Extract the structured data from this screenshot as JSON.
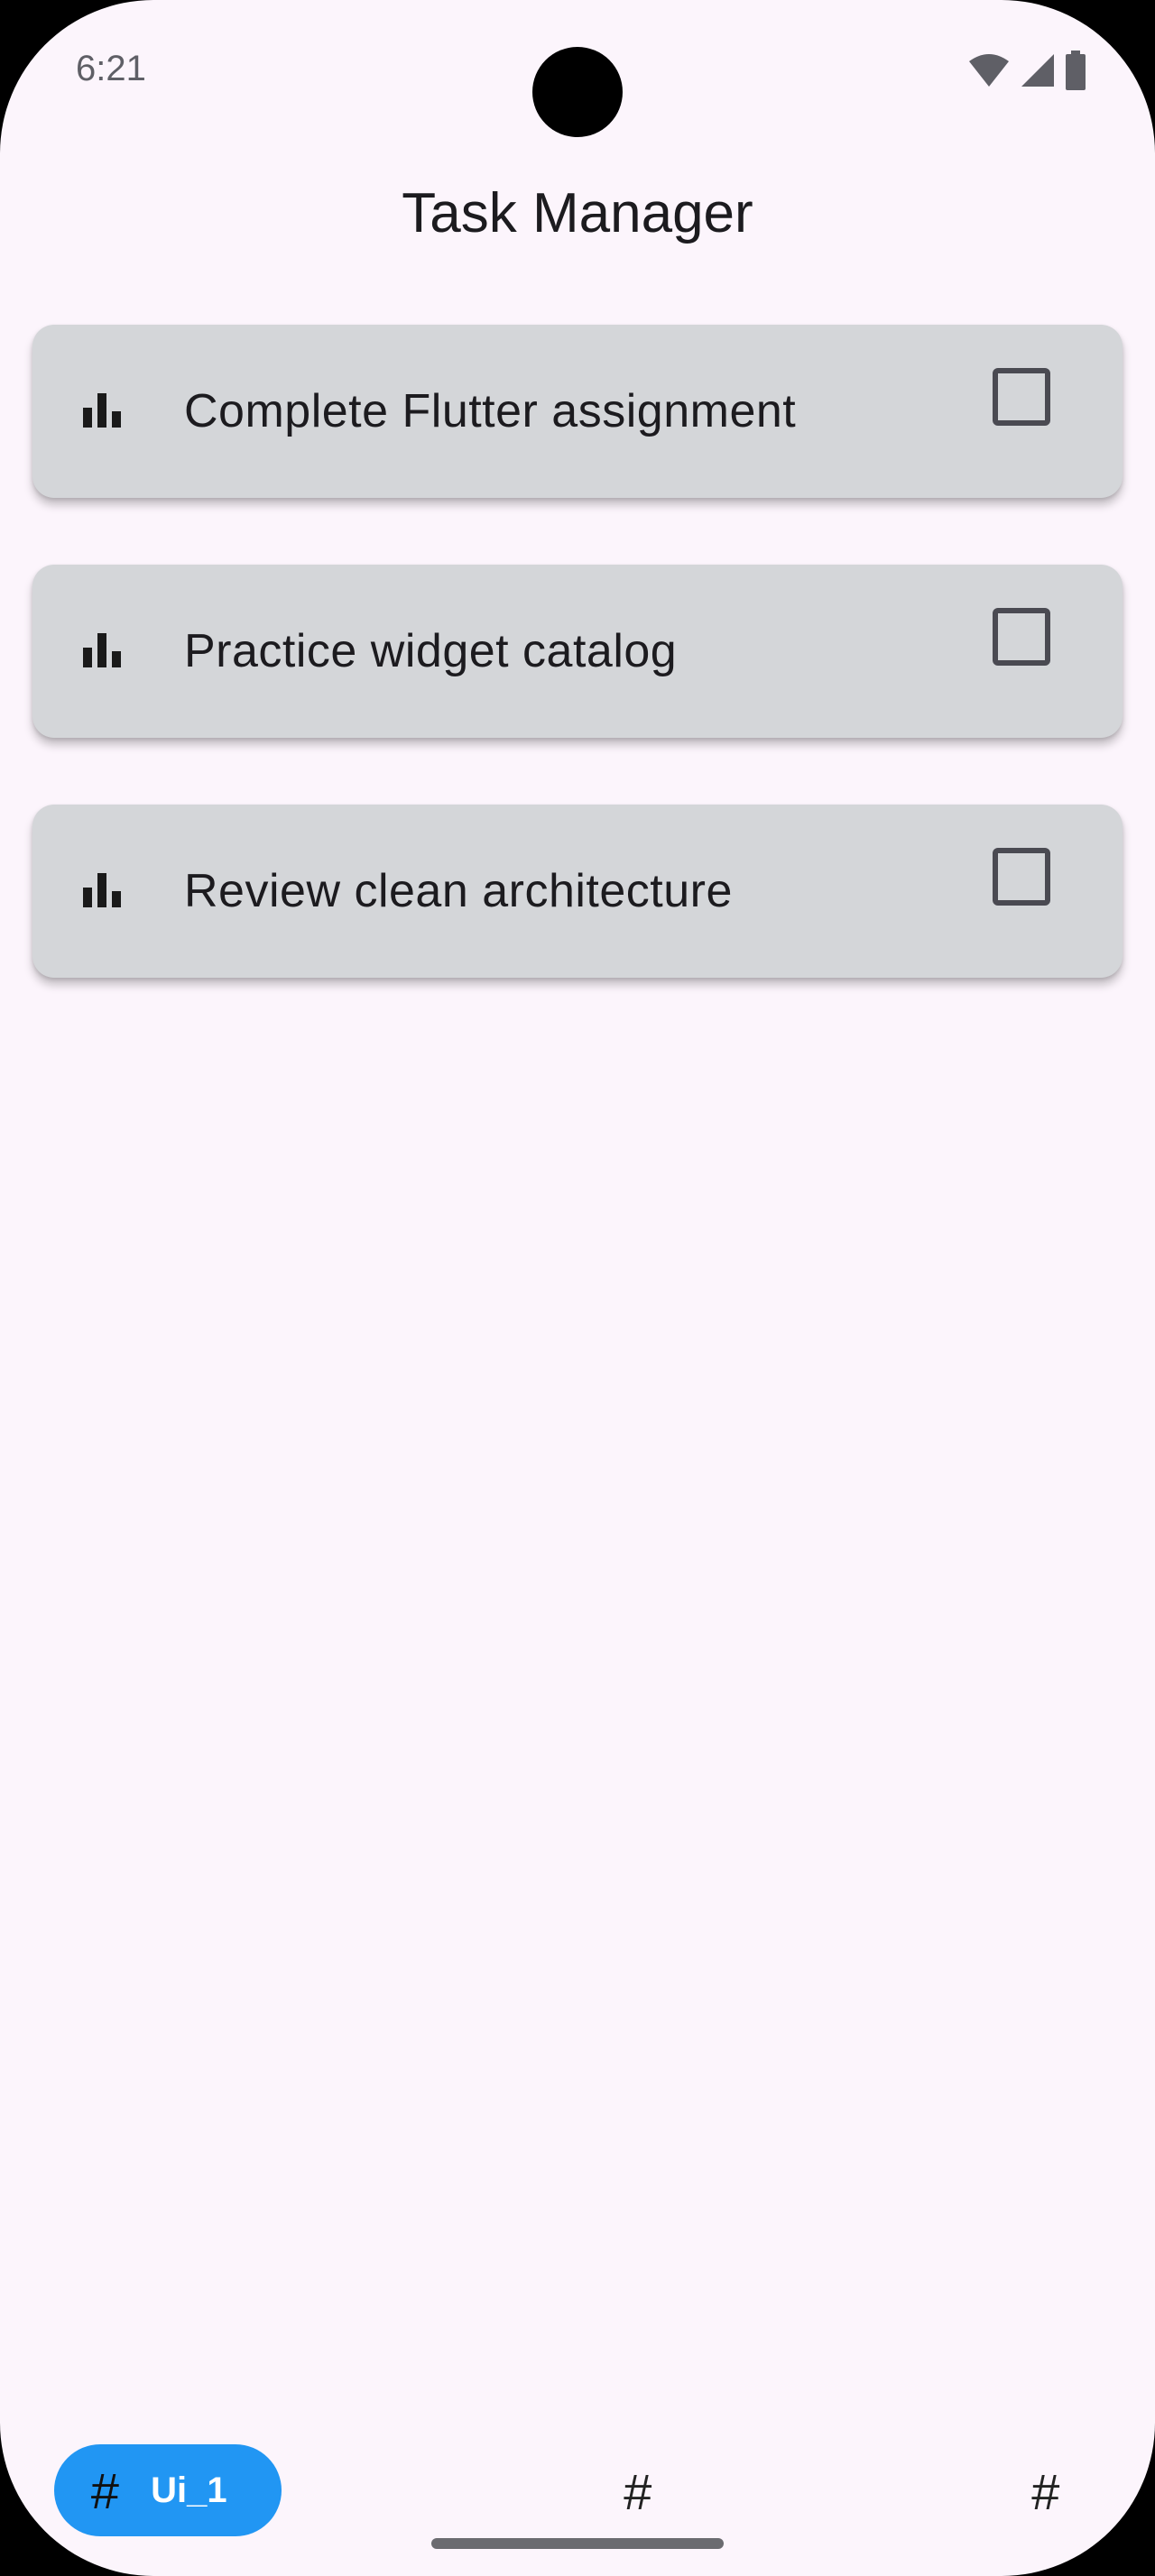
{
  "status_bar": {
    "time": "6:21",
    "icons": [
      "wifi-icon",
      "cellular-signal-icon",
      "battery-icon"
    ]
  },
  "app_bar": {
    "title": "Task Manager"
  },
  "tasks": [
    {
      "label": "Complete Flutter assignment",
      "icon": "bar-chart-icon",
      "checked": false
    },
    {
      "label": "Practice widget catalog",
      "icon": "bar-chart-icon",
      "checked": false
    },
    {
      "label": "Review clean architecture",
      "icon": "bar-chart-icon",
      "checked": false
    }
  ],
  "bottom_nav": {
    "items": [
      {
        "icon_glyph": "#",
        "label": "Ui_1",
        "active": true
      },
      {
        "icon_glyph": "#",
        "label": "",
        "active": false
      },
      {
        "icon_glyph": "#",
        "label": "",
        "active": false
      }
    ]
  },
  "colors": {
    "background": "#fcf5fc",
    "card": "#d4d6d9",
    "active_nav": "#2196f3",
    "text": "#1c1b1f"
  }
}
